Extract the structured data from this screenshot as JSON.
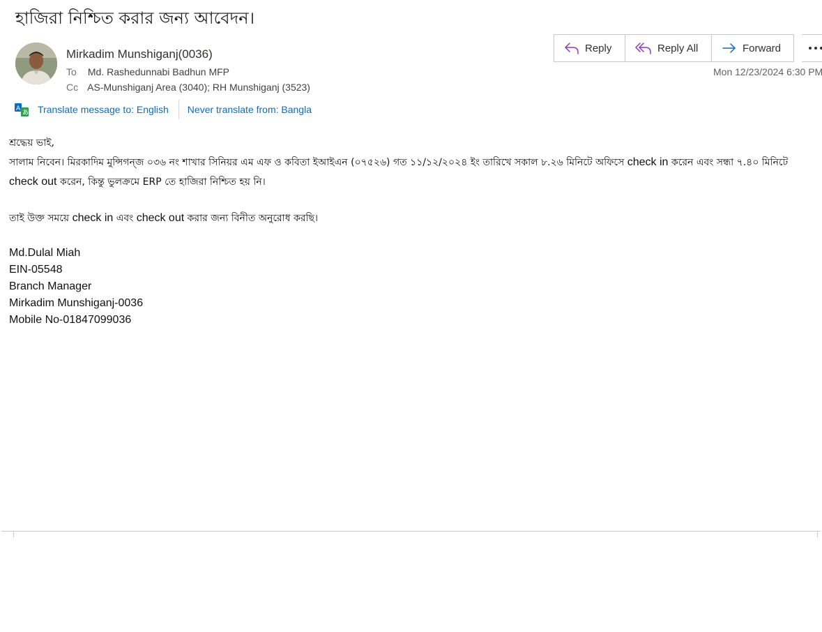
{
  "subject": "হাজিরা নিশ্চিত করার জন্য আবেদন।",
  "sender": {
    "name": "Mirkadim Munshiganj(0036)",
    "avatar_icon": "person-photo-icon"
  },
  "recipients": {
    "to_label": "To",
    "to_value": "Md. Rashedunnabi Badhun MFP",
    "cc_label": "Cc",
    "cc_value": "AS-Munshiganj Area (3040); RH Munshiganj (3523)"
  },
  "actions": {
    "reply_label": "Reply",
    "reply_all_label": "Reply All",
    "forward_label": "Forward",
    "more_icon": "more-options-icon"
  },
  "date": "Mon 12/23/2024 6:30 PM",
  "translate": {
    "translate_label": "Translate message to: English",
    "never_label": "Never translate from: Bangla"
  },
  "body": {
    "greeting": "শ্রদ্ধেয় ভাই,",
    "para1_a": "সালাম নিবেন। মিরকাদিম মুন্সিগন্জ ০৩৬ নং শাখার  সিনিয়র এম এফ ও কবিতা ইআইএন  (০৭৫২৬)   গত ১১/১২/২০২৪ ইং তারিখে সকাল ৮.২৬ মিনিটে অফিসে ",
    "check_in": "check in",
    "para1_b": " করেন এবং সন্ধা ৭.৪০ মিনিটে ",
    "check_out": "check out",
    "para1_c": " করেন, কিন্তু ভুলক্রমে  ERP তে হাজিরা নিশ্চিত  হয় নি।",
    "para2_a": "তাই উক্ত সময়ে ",
    "para2_checkin": "check in",
    "para2_b": " এবং ",
    "para2_checkout": "check out",
    "para2_c": " করার জন্য বিনীত অনুরোধ করছি।",
    "signature": [
      "Md.Dulal Miah",
      "EIN-05548",
      "Branch Manager",
      "Mirkadim Munshiganj-0036",
      "Mobile No-01847099036"
    ]
  },
  "colors": {
    "link": "#0f6cbd",
    "reply_icon": "#8a3ab9",
    "forward_icon": "#0f6cbd"
  }
}
